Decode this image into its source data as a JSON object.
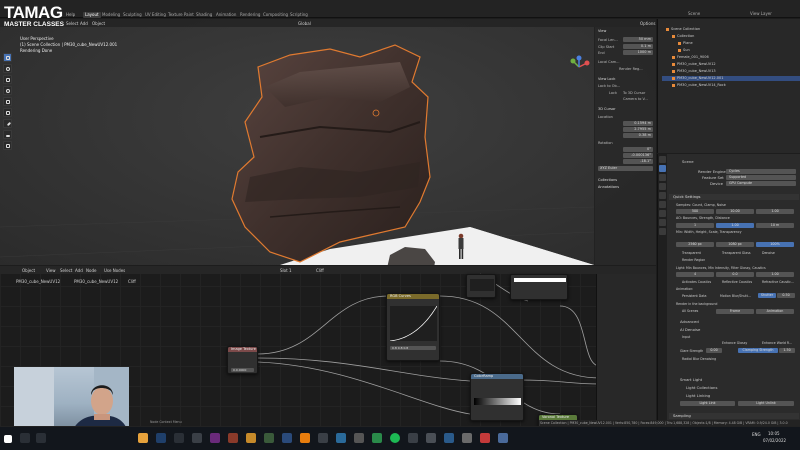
{
  "watermark": {
    "line1": "TAMAG",
    "line2": "MASTER CLASSES"
  },
  "topbar": {
    "menus": [
      "Help"
    ],
    "workspaces": [
      "Layout",
      "Modeling",
      "Sculpting",
      "UV Editing",
      "Texture Paint",
      "Shading",
      "Animation",
      "Rendering",
      "Compositing",
      "Scripting"
    ],
    "active_workspace": "Layout",
    "scene_label": "Scene",
    "view_layer_label": "View Layer",
    "options_label": "Options"
  },
  "viewport": {
    "header_items": [
      "Select",
      "Add",
      "Object"
    ],
    "transform": "Global",
    "overlay_lines": [
      "User Perspective",
      "(1) Scene Collection | PM30_cube_NewUV12.001",
      "Rendering Done"
    ]
  },
  "npanel": {
    "view_header": "View",
    "focal_label": "Focal Len...",
    "focal_value": "50 mm",
    "clip_start_label": "Clip Start",
    "clip_start_value": "0.1 m",
    "clip_end_label": "End",
    "clip_end_value": "1000 m",
    "local_camera_label": "Local Cam...",
    "render_region_label": "Render Reg...",
    "view_lock_header": "View Lock",
    "lock_to_obj_label": "Lock to Ob...",
    "lock_label": "Lock",
    "to_3d_cursor": "To 3D Cursor",
    "camera_to_view": "Camera to V...",
    "cursor_header": "3D Cursor",
    "location_label": "Location",
    "cursor_x": "0.1594 m",
    "cursor_y": "2.7955 m",
    "cursor_z": "0.38 m",
    "rotation_label": "Rotation",
    "rot_x": "0°",
    "rot_y": "-0.000136°",
    "rot_z": "-18.1°",
    "rot_mode": "XYZ Euler",
    "collections_header": "Collections",
    "annotations_header": "Annotations"
  },
  "outliner": {
    "rows": [
      {
        "label": "Scene Collection",
        "selected": false,
        "indent": 0
      },
      {
        "label": "Collection",
        "selected": false,
        "indent": 1
      },
      {
        "label": "Plane",
        "selected": false,
        "indent": 2
      },
      {
        "label": "Sun",
        "selected": false,
        "indent": 2
      },
      {
        "label": "Female_001_9006",
        "selected": false,
        "indent": 1
      },
      {
        "label": "PM30_cube_NewUV12",
        "selected": false,
        "indent": 1
      },
      {
        "label": "PM30_cube_NewUV13",
        "selected": false,
        "indent": 1
      },
      {
        "label": "PM30_cube_NewUV12.001",
        "selected": true,
        "indent": 1
      },
      {
        "label": "PM30_cube_NewUV14_Rock",
        "selected": false,
        "indent": 1
      }
    ]
  },
  "props": {
    "scene_label": "Scene",
    "render_engine_label": "Render Engine",
    "render_engine": "Cycles",
    "feature_set_label": "Feature Set",
    "feature_set": "Supported",
    "device_label": "Device",
    "device": "GPU Compute",
    "quick_settings": "Quick Settings",
    "samples_label": "Samples: Count, Clamp, Noise",
    "samples": [
      "500",
      "10.00",
      "1.00"
    ],
    "ao_label": "AO: Bounces, Strength, Distance",
    "ao": [
      "1",
      "1.00",
      "10 m"
    ],
    "min_label": "Min: Width, Height, Scale, Transparency",
    "min": [
      "2560 px",
      "1080 px",
      "100%"
    ],
    "checks1": [
      "Transparent",
      "Transparent Glass",
      "Denoise"
    ],
    "render_region": "Render Region",
    "light_label": "Light: Min Bounces, Min Intensity, Filter Glossy, Caustics",
    "light": [
      "4",
      "0.0",
      "1.00"
    ],
    "caustics": [
      "Activates Caustics",
      "Reflective Caustics",
      "Refractive Caustic..."
    ],
    "animation_label": "Animation:",
    "anim": [
      "Persistent Data",
      "Motion Blur/Shutt...",
      "Shutter",
      "0.50"
    ],
    "bg_label": "Render in the background",
    "bg_options": [
      "All Scenes",
      "Frame",
      "Animation"
    ],
    "advanced": "Advanced",
    "ai_denoise": "AI Denoise",
    "denoise_opts": [
      "Input",
      "Enhance Glossy",
      "Enhance World R..."
    ],
    "glare_strength_label": "Glare Strength",
    "glare_strength": "0.00",
    "clamping_label": "Clamping Strength",
    "clamping": "1.50",
    "radial_label": "Radial Blur Denoising",
    "smart_light": "Smart Light",
    "light_collections": "Light Collections",
    "light_linking": "Light Linking",
    "light_link_btn": "Light Link",
    "light_unlink_btn": "Light Unlink",
    "sampling": "Sampling"
  },
  "node_editor": {
    "header_items": [
      "Object",
      "View",
      "Select",
      "Add",
      "Node",
      "Use Nodes"
    ],
    "slot": "Slot 1",
    "material": "Cliff",
    "breadcrumb": [
      "PM30_cube_NewUV12",
      "PM30_cube_NewUV12",
      "Cliff"
    ],
    "annotations": "Annotations",
    "nodes": {
      "rgb_curves": "RGB Curves",
      "image_texture": "Image Texture",
      "colorramp": "ColorRamp",
      "bump": "Bump",
      "voronoi": "Voronoi Texture"
    },
    "node_values": [
      "0.8 0.8 0.8",
      "0.0.0000"
    ]
  },
  "status_bar": "Scene Collection | PM30_cube_NewUV12.001 | Verts:850,780 | Faces:849,000 | Tris:1,688,328 | Objects:1/8 | Memory: 4.48 GiB | VRAM: 0.9/24.0 GiB | 3.0.0",
  "taskbar": {
    "time": "10:05",
    "date": "07/02/2022",
    "lang": "ENG"
  }
}
